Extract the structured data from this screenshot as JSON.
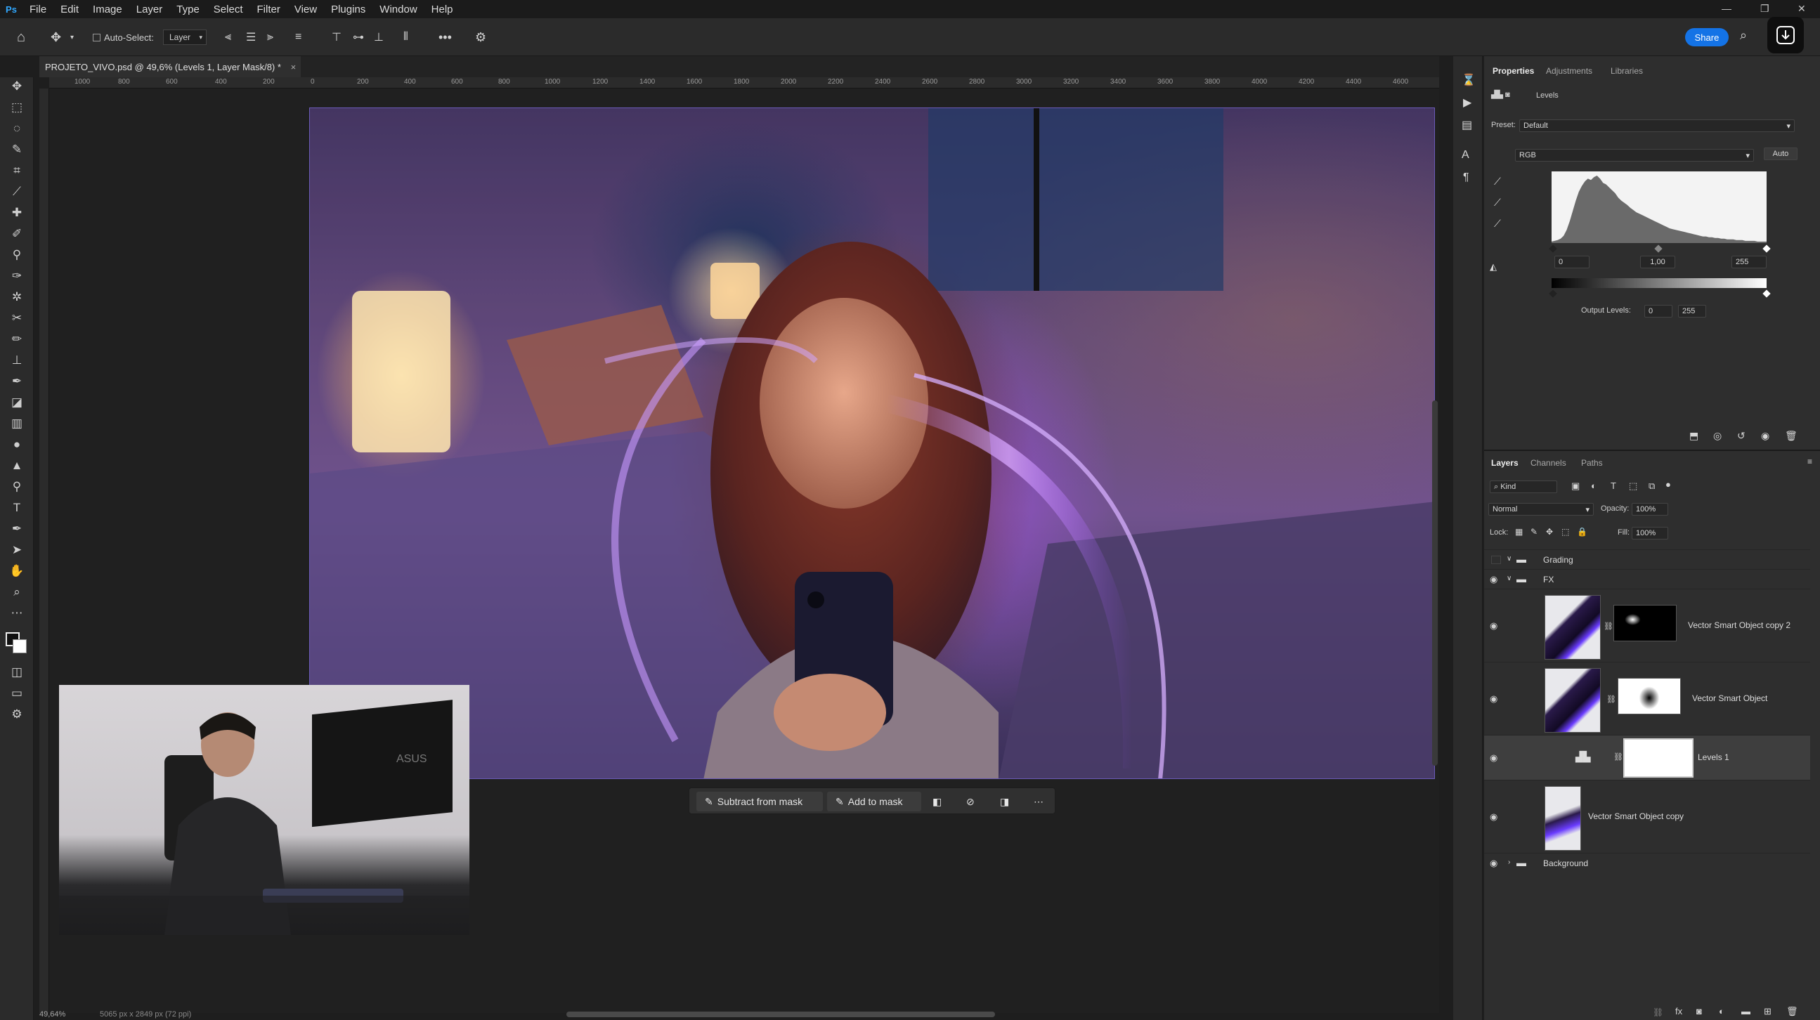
{
  "menubar": {
    "items": [
      "File",
      "Edit",
      "Image",
      "Layer",
      "Type",
      "Select",
      "Filter",
      "View",
      "Plugins",
      "Window",
      "Help"
    ]
  },
  "options_bar": {
    "auto_select_label": "Auto-Select:",
    "auto_select_target": "Layer",
    "share_label": "Share"
  },
  "document": {
    "tab_title": "PROJETO_VIVO.psd @ 49,6% (Levels 1, Layer Mask/8) *",
    "zoom": "49,64%",
    "doc_info": "5065 px x 2849 px (72 ppi)"
  },
  "ruler": {
    "labels": [
      "1000",
      "800",
      "600",
      "400",
      "200",
      "0",
      "200",
      "400",
      "600",
      "800",
      "1000",
      "1200",
      "1400",
      "1600",
      "1800",
      "2000",
      "2200",
      "2400",
      "2600",
      "2800",
      "3000",
      "3200",
      "3400",
      "3600",
      "3800",
      "4000",
      "4200",
      "4400",
      "4600"
    ]
  },
  "mask_bar": {
    "subtract": "Subtract from mask",
    "add": "Add to mask"
  },
  "properties": {
    "tabs": [
      "Properties",
      "Adjustments",
      "Libraries"
    ],
    "adjustment_name": "Levels",
    "preset_label": "Preset:",
    "preset_value": "Default",
    "channel": "RGB",
    "auto_label": "Auto",
    "input_black": "0",
    "input_gamma": "1,00",
    "input_white": "255",
    "output_label": "Output Levels:",
    "output_black": "0",
    "output_white": "255",
    "histogram": [
      2,
      3,
      4,
      6,
      10,
      18,
      30,
      44,
      58,
      70,
      78,
      84,
      88,
      86,
      90,
      92,
      88,
      82,
      80,
      76,
      72,
      68,
      62,
      58,
      55,
      52,
      48,
      45,
      42,
      40,
      38,
      36,
      34,
      32,
      30,
      28,
      26,
      24,
      22,
      20,
      19,
      18,
      17,
      16,
      15,
      14,
      13,
      12,
      11,
      10,
      9,
      9,
      8,
      8,
      7,
      7,
      6,
      6,
      5,
      5,
      5,
      4,
      4,
      4,
      3,
      3,
      3,
      3,
      2,
      2,
      2,
      2
    ]
  },
  "layers_panel": {
    "tabs": [
      "Layers",
      "Channels",
      "Paths"
    ],
    "filter_kind": "Kind",
    "blend_mode": "Normal",
    "opacity_label": "Opacity:",
    "opacity_value": "100%",
    "lock_label": "Lock:",
    "fill_label": "Fill:",
    "fill_value": "100%",
    "layers": [
      {
        "name": "Grading",
        "type": "group"
      },
      {
        "name": "FX",
        "type": "group"
      },
      {
        "name": "Vector Smart Object copy 2",
        "type": "smart"
      },
      {
        "name": "Vector Smart Object",
        "type": "smart"
      },
      {
        "name": "Levels 1",
        "type": "adjustment"
      },
      {
        "name": "Vector Smart Object copy",
        "type": "smart"
      },
      {
        "name": "Background",
        "type": "group"
      }
    ]
  },
  "video_inset": {
    "monitor_brand": "ASUS"
  },
  "colors": {
    "accent": "#1473e6",
    "panel_bg": "#2e2e2e",
    "selected_layer": "#3e3e3e"
  }
}
